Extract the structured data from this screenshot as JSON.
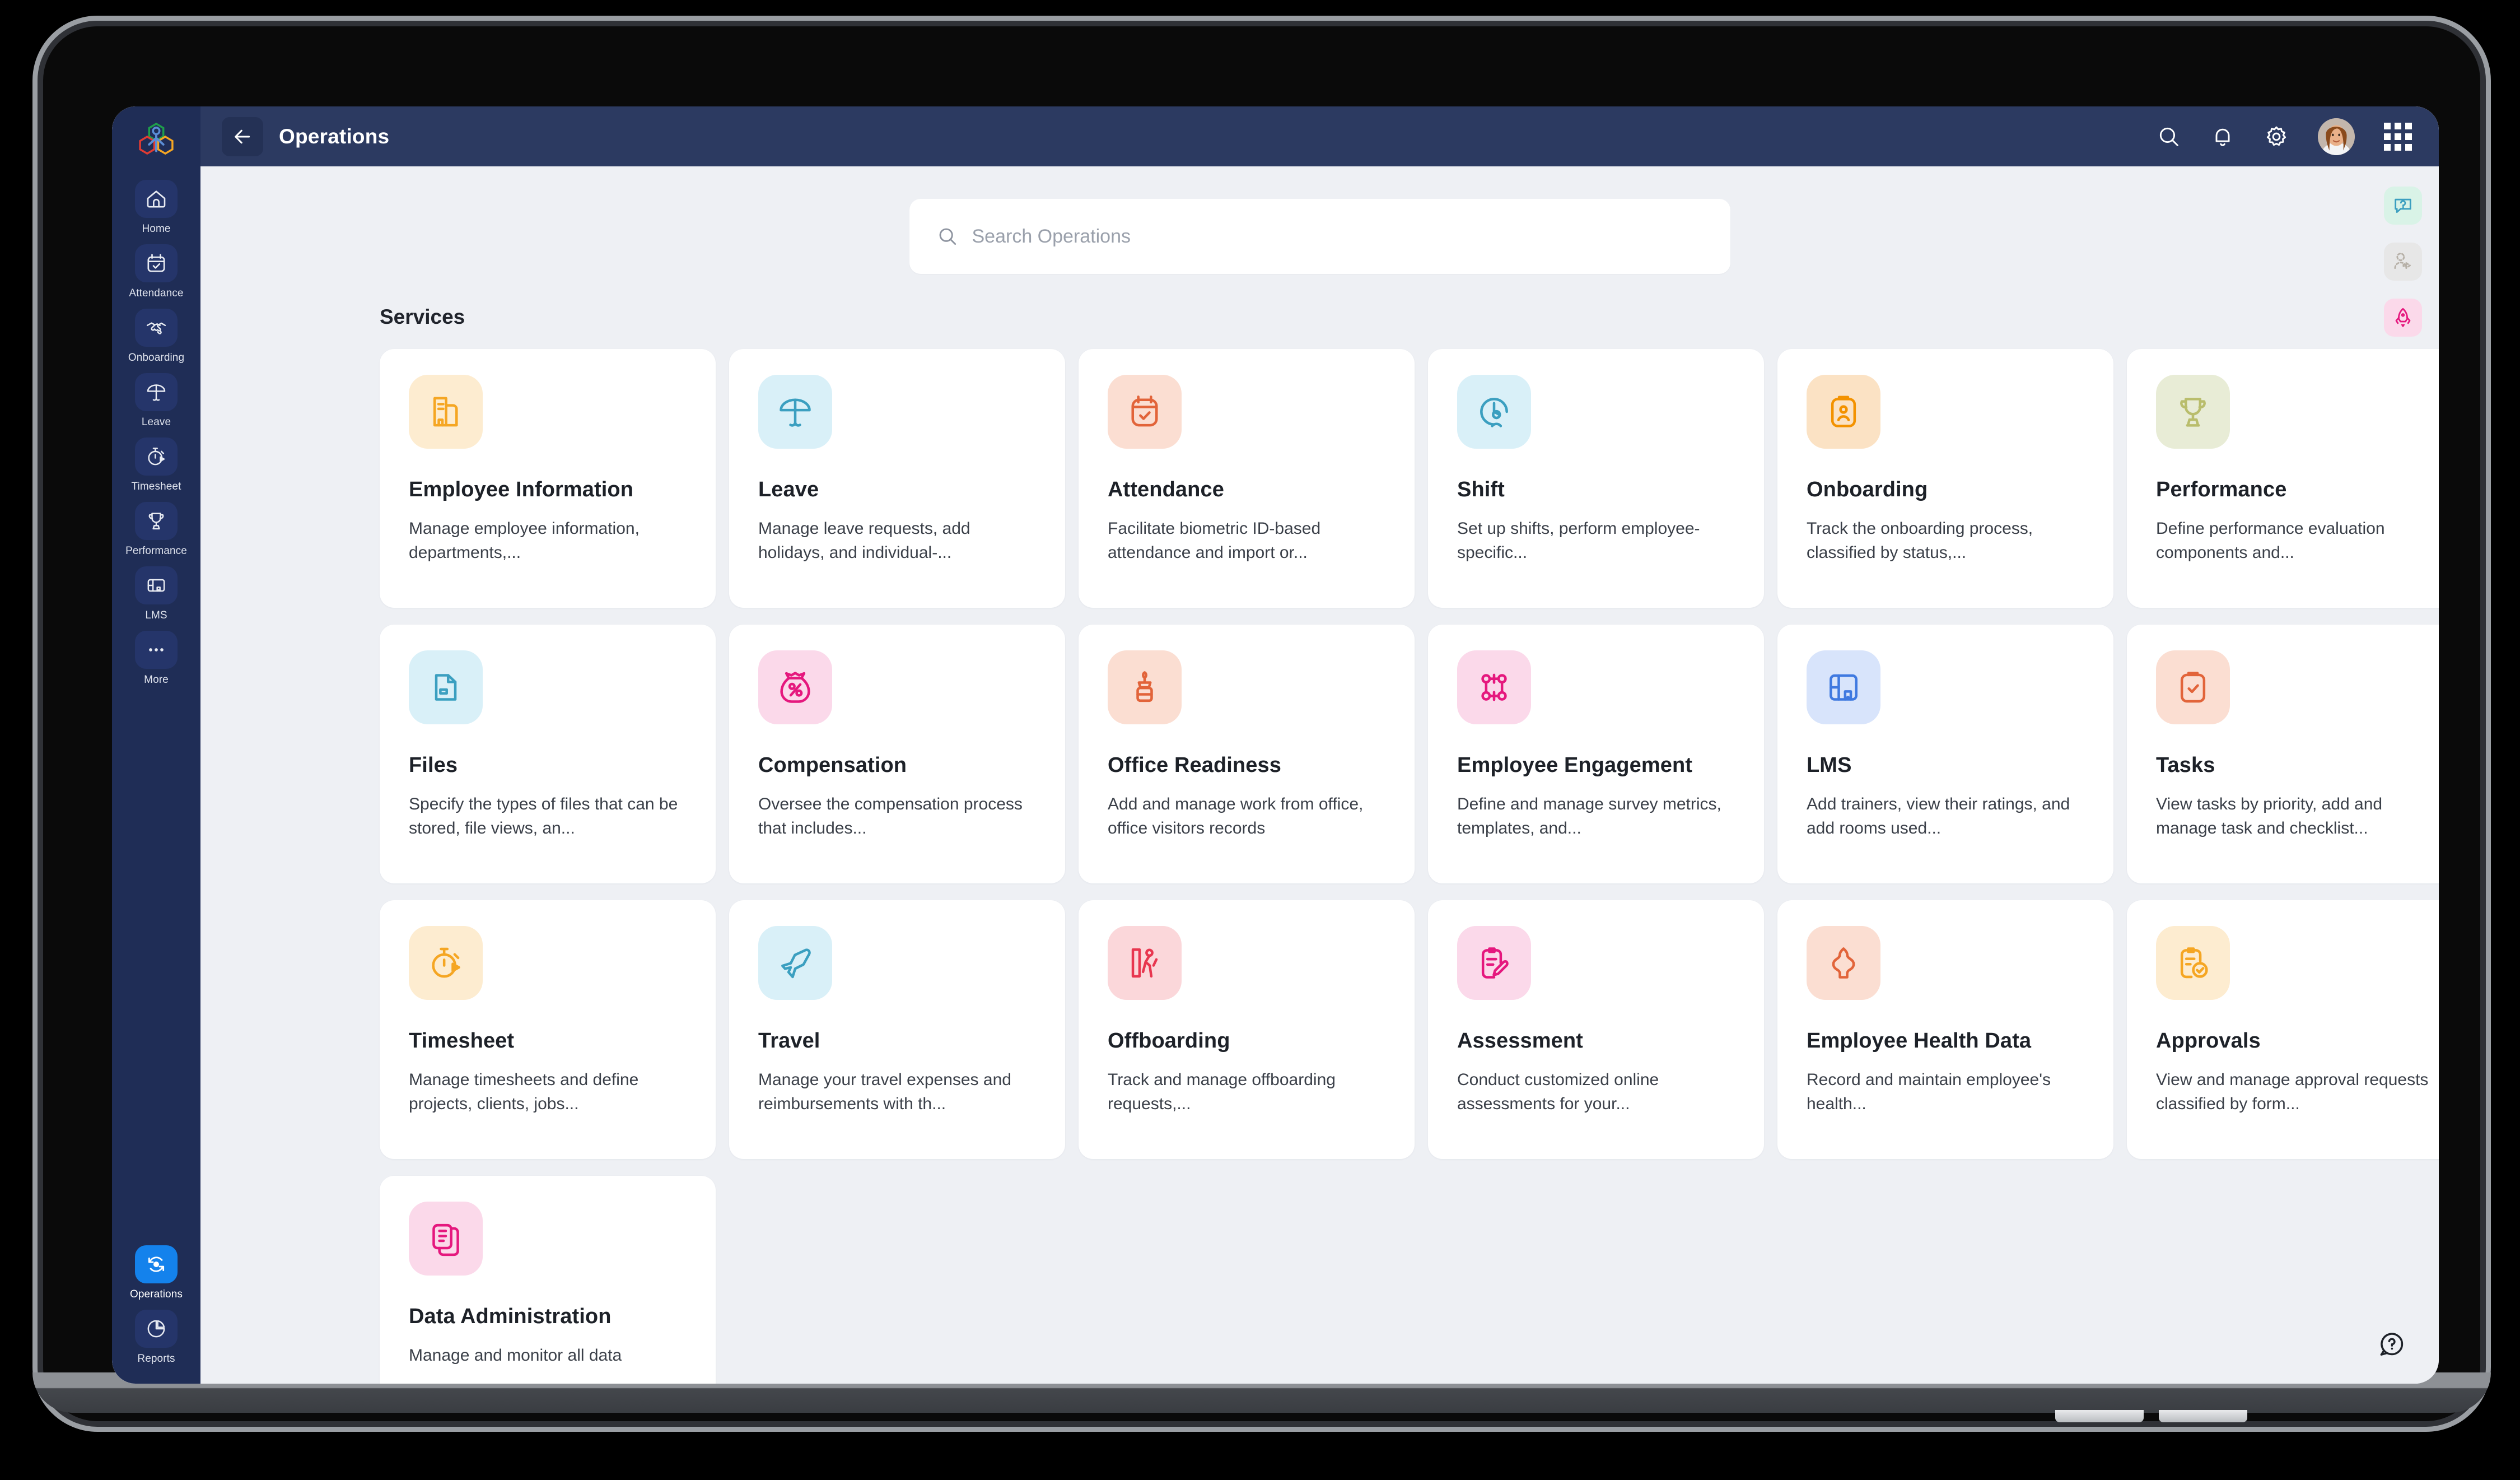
{
  "app": {
    "logo": "hexagon-people-logo"
  },
  "header": {
    "title": "Operations",
    "back_icon": "arrow-left-icon",
    "actions": [
      {
        "name": "search-icon",
        "label": "Search"
      },
      {
        "name": "bell-icon",
        "label": "Notifications"
      },
      {
        "name": "gear-icon",
        "label": "Settings"
      }
    ],
    "avatar_name": "user-avatar",
    "apps_grid_label": "Apps"
  },
  "sidebar": {
    "items": [
      {
        "label": "Home",
        "icon": "home-icon",
        "active": false
      },
      {
        "label": "Attendance",
        "icon": "calendar-check-icon",
        "active": false
      },
      {
        "label": "Onboarding",
        "icon": "handshake-icon",
        "active": false
      },
      {
        "label": "Leave",
        "icon": "beach-umbrella-icon",
        "active": false
      },
      {
        "label": "Timesheet",
        "icon": "stopwatch-icon",
        "active": false
      },
      {
        "label": "Performance",
        "icon": "trophy-icon",
        "active": false
      },
      {
        "label": "LMS",
        "icon": "book-icon",
        "active": false
      },
      {
        "label": "More",
        "icon": "ellipsis-icon",
        "active": false
      }
    ],
    "bottom_items": [
      {
        "label": "Operations",
        "icon": "operations-refresh-icon",
        "active": true
      },
      {
        "label": "Reports",
        "icon": "pie-chart-icon",
        "active": false
      }
    ]
  },
  "search": {
    "placeholder": "Search Operations",
    "value": "",
    "icon": "search-icon"
  },
  "main": {
    "section_title": "Services",
    "cards": [
      {
        "title": "Employee Information",
        "desc": "Manage employee information, departments,...",
        "icon": "building-document-icon",
        "icon_color": "#f5a623",
        "tile_color": "#fdecd0"
      },
      {
        "title": "Leave",
        "desc": "Manage leave requests, add holidays, and individual-...",
        "icon": "beach-umbrella-icon",
        "icon_color": "#3b9fc0",
        "tile_color": "#d9f0f8"
      },
      {
        "title": "Attendance",
        "desc": "Facilitate biometric ID-based attendance and import or...",
        "icon": "calendar-check-icon",
        "icon_color": "#e2643a",
        "tile_color": "#fbded2"
      },
      {
        "title": "Shift",
        "desc": "Set up shifts, perform employee-specific...",
        "icon": "shift-clock-person-icon",
        "icon_color": "#3b9fc0",
        "tile_color": "#d9f0f8"
      },
      {
        "title": "Onboarding",
        "desc": "Track the onboarding process, classified by status,...",
        "icon": "clipboard-person-icon",
        "icon_color": "#f39200",
        "tile_color": "#fbe2c4"
      },
      {
        "title": "Performance",
        "desc": "Define performance evaluation components and...",
        "icon": "trophy-icon",
        "icon_color": "#b9bd6c",
        "tile_color": "#e8ecd6"
      },
      {
        "title": "Files",
        "desc": "Specify the types of files that can be stored, file views, an...",
        "icon": "file-folder-icon",
        "icon_color": "#3b9fc0",
        "tile_color": "#d9f0f8"
      },
      {
        "title": "Compensation",
        "desc": "Oversee the compensation process that includes...",
        "icon": "money-bag-icon",
        "icon_color": "#e5187e",
        "tile_color": "#fbd9ea"
      },
      {
        "title": "Office Readiness",
        "desc": "Add and manage work from office, office visitors records",
        "icon": "office-desk-icon",
        "icon_color": "#e2643a",
        "tile_color": "#fbded2"
      },
      {
        "title": "Employee Engagement",
        "desc": "Define and manage survey metrics, templates, and...",
        "icon": "engagement-network-icon",
        "icon_color": "#e5187e",
        "tile_color": "#fbd9ea"
      },
      {
        "title": "LMS",
        "desc": "Add trainers, view their ratings, and add rooms used...",
        "icon": "book-icon",
        "icon_color": "#3f79e0",
        "tile_color": "#d8e4fb"
      },
      {
        "title": "Tasks",
        "desc": "View tasks by priority, add and manage task and checklist...",
        "icon": "clipboard-check-icon",
        "icon_color": "#e2643a",
        "tile_color": "#fbded2"
      },
      {
        "title": "Timesheet",
        "desc": "Manage timesheets and define projects, clients, jobs...",
        "icon": "stopwatch-icon",
        "icon_color": "#f5a623",
        "tile_color": "#fdecd0"
      },
      {
        "title": "Travel",
        "desc": "Manage your travel expenses and reimbursements with th...",
        "icon": "airplane-icon",
        "icon_color": "#3b9fc0",
        "tile_color": "#d9f0f8"
      },
      {
        "title": "Offboarding",
        "desc": "Track and manage offboarding requests,...",
        "icon": "exit-door-icon",
        "icon_color": "#e8364f",
        "tile_color": "#fbd7da"
      },
      {
        "title": "Assessment",
        "desc": "Conduct customized online assessments for your...",
        "icon": "clipboard-pencil-icon",
        "icon_color": "#e5187e",
        "tile_color": "#fbd9ea"
      },
      {
        "title": "Employee Health Data",
        "desc": "Record and maintain employee's health...",
        "icon": "health-body-icon",
        "icon_color": "#e2643a",
        "tile_color": "#fbded2"
      },
      {
        "title": "Approvals",
        "desc": "View and manage approval requests classified by form...",
        "icon": "approval-check-icon",
        "icon_color": "#f5a623",
        "tile_color": "#fdecd0"
      },
      {
        "title": "Data Administration",
        "desc": "Manage and monitor all data",
        "icon": "documents-stack-icon",
        "icon_color": "#e5187e",
        "tile_color": "#fbd9ea"
      }
    ]
  },
  "float_rail": {
    "buttons": [
      {
        "name": "help-chat-icon",
        "tile_color": "#d9f3e7",
        "icon_color": "#3b9fc0"
      },
      {
        "name": "refer-user-icon",
        "tile_color": "#e6e6e6",
        "icon_color": "#b7b1a8"
      },
      {
        "name": "rocket-icon",
        "tile_color": "#fbd9ea",
        "icon_color": "#e5187e"
      }
    ],
    "help_fab": "help-question-icon"
  }
}
